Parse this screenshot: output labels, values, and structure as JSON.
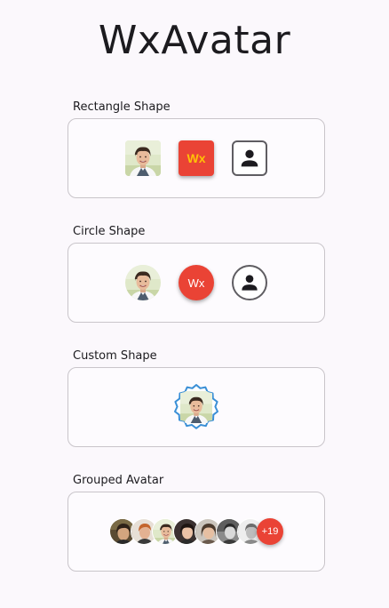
{
  "app": {
    "title": "WxAvatar"
  },
  "sections": [
    {
      "label": "Rectangle Shape"
    },
    {
      "label": "Circle Shape"
    },
    {
      "label": "Custom Shape"
    },
    {
      "label": "Grouped Avatar"
    }
  ],
  "rectangle": {
    "text_avatar_label": "Wx",
    "text_color": "#ffc107",
    "background_color": "#ea4335",
    "icon": "person-icon"
  },
  "circle": {
    "text_avatar_label": "Wx",
    "text_color": "#ffffff",
    "background_color": "#ea4335",
    "icon": "person-icon"
  },
  "custom": {
    "border_color": "#3a8fd6"
  },
  "grouped": {
    "more_count": "+19",
    "more_color": "#ea4335"
  }
}
